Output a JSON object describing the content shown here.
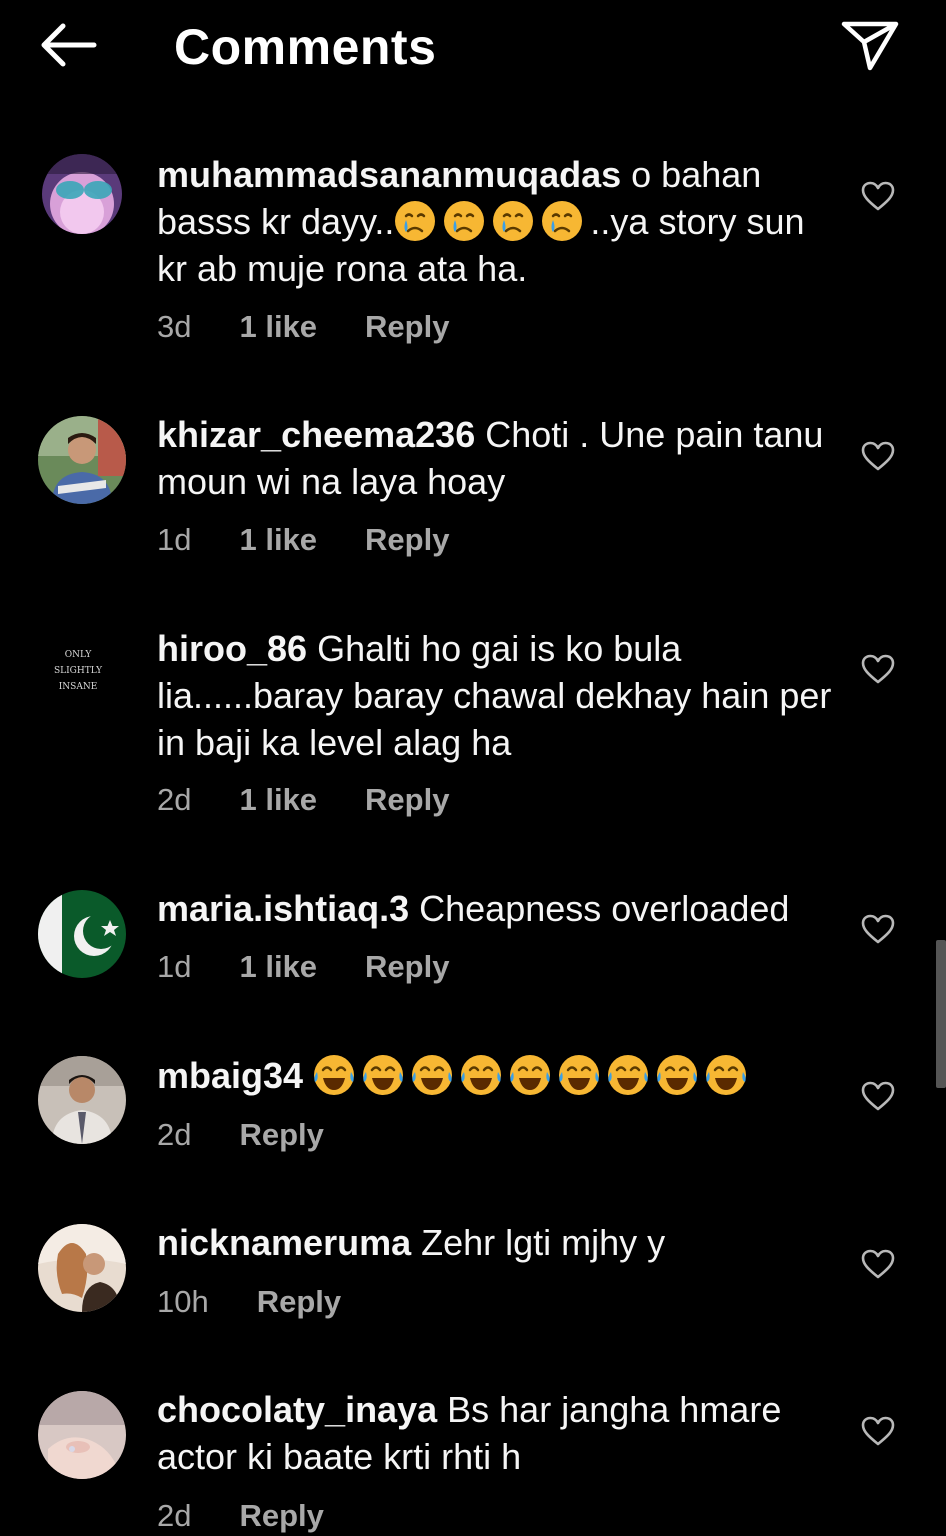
{
  "header": {
    "title": "Comments",
    "back_icon": "arrow-left-icon",
    "share_icon": "paper-plane-icon"
  },
  "comments": [
    {
      "username": "muhammadsananmuqadas",
      "text_before": "o bahan basss kr dayy..",
      "emoji": "crying-face",
      "emoji_count": 4,
      "text_after": "..ya story sun kr ab muje rona ata ha.",
      "time": "3d",
      "likes": "1 like",
      "reply": "Reply"
    },
    {
      "username": "khizar_cheema236",
      "text_before": "Choti . Une pain tanu moun wi  na laya hoay",
      "time": "1d",
      "likes": "1 like",
      "reply": "Reply"
    },
    {
      "username": "hiroo_86",
      "text_before": "Ghalti ho gai is ko bula lia......baray baray chawal dekhay hain per in baji ka level alag ha",
      "time": "2d",
      "likes": "1 like",
      "reply": "Reply",
      "avatar_text": [
        "ONLY",
        "SLIGHTLY",
        "INSANE"
      ]
    },
    {
      "username": "maria.ishtiaq.3",
      "text_before": "Cheapness overloaded",
      "time": "1d",
      "likes": "1 like",
      "reply": "Reply"
    },
    {
      "username": "mbaig34",
      "text_before": "",
      "emoji": "face-with-tears-of-joy",
      "emoji_count": 9,
      "time": "2d",
      "reply": "Reply"
    },
    {
      "username": "nicknameruma",
      "text_before": "Zehr lgti mjhy y",
      "time": "10h",
      "reply": "Reply"
    },
    {
      "username": "chocolaty_inaya",
      "text_before": "Bs har jangha hmare actor ki baate krti rhti h",
      "time": "2d",
      "reply": "Reply"
    }
  ],
  "colors": {
    "background": "#000000",
    "text": "#f5f5f5",
    "secondary_text": "#a8a8a8",
    "heart_outline": "#b8b8b8",
    "scrollbar": "#555555"
  }
}
